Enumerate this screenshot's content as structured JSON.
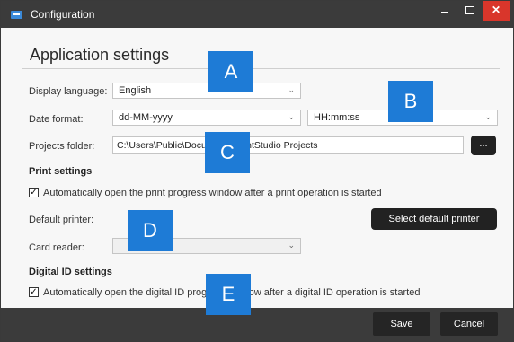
{
  "window": {
    "title": "Configuration",
    "minimize": "−",
    "close": "✕"
  },
  "heading": "Application settings",
  "display_language": {
    "label": "Display language:",
    "value": "English"
  },
  "date_format": {
    "label": "Date format:",
    "date_value": "dd-MM-yyyy",
    "time_value": "HH:mm:ss"
  },
  "projects_folder": {
    "label": "Projects folder:",
    "value": "C:\\Users\\Public\\Documents\\PrintStudio Projects",
    "browse_label": "..."
  },
  "print_settings": {
    "heading": "Print settings",
    "auto_open_label": "Automatically open the print progress window after a print operation is started",
    "default_printer_label": "Default printer:",
    "select_printer_button": "Select default printer",
    "card_reader_label": "Card reader:"
  },
  "digital_id": {
    "heading": "Digital ID settings",
    "auto_open_label": "Automatically open the digital ID progress window after a digital ID operation is started"
  },
  "footer": {
    "save": "Save",
    "cancel": "Cancel"
  },
  "markers": [
    "A",
    "B",
    "C",
    "D",
    "E"
  ],
  "colors": {
    "titlebar": "#3b3b3b",
    "close": "#d9362b",
    "marker": "#1e7bd6",
    "button_dark": "#222222"
  },
  "icons": {
    "chevron": "⌄",
    "check": "✓"
  }
}
